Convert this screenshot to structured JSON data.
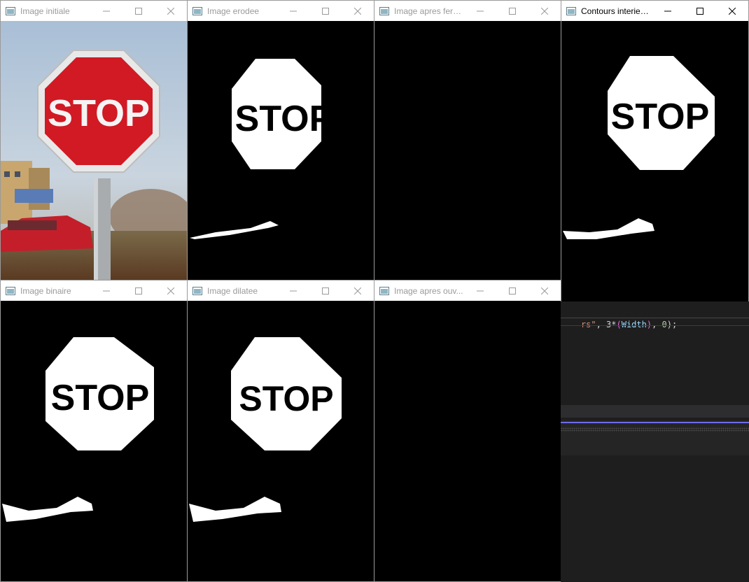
{
  "windows": {
    "initial": {
      "title": "Image initiale"
    },
    "eroded": {
      "title": "Image erodee"
    },
    "closing": {
      "title": "Image apres ferm..."
    },
    "contours": {
      "title": "Contours interieurs"
    },
    "binary": {
      "title": "Image binaire"
    },
    "dilated": {
      "title": "Image dilatee"
    },
    "opening": {
      "title": "Image apres  ouv..."
    }
  },
  "sign": {
    "text": "STOP"
  },
  "code": {
    "str_part": "rs\"",
    "sep": ", 3*",
    "open_paren": "(",
    "var": "Width",
    "close_paren": ")",
    "sep2": ", ",
    "zero": "0",
    "end": ");"
  },
  "colors": {
    "sign_red": "#d11a24",
    "code_string": "#ce9178",
    "accent": "#6f6ae8"
  }
}
